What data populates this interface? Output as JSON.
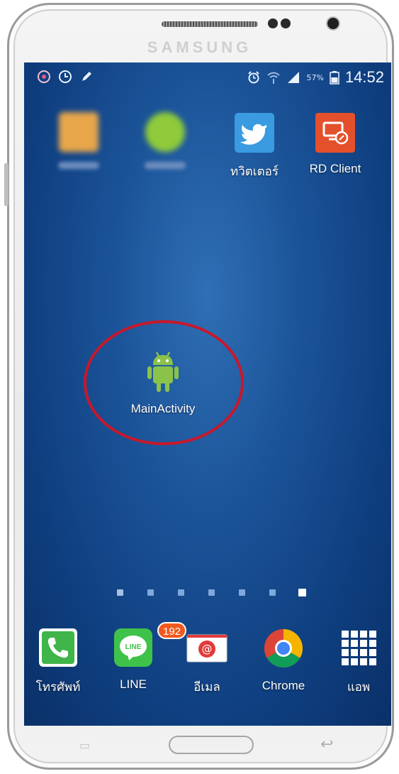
{
  "device": {
    "brand": "SAMSUNG"
  },
  "status_bar": {
    "time": "14:52",
    "battery_percent": "57%",
    "left_icons": [
      "messenger-icon",
      "clock-icon",
      "pencil-icon"
    ],
    "right_icons": [
      "alarm-icon",
      "wifi-icon",
      "signal-icon",
      "battery-icon"
    ]
  },
  "home_screen": {
    "top_row": [
      {
        "label": "",
        "icon": "blurred-orange-app-icon",
        "color": "#e8a64a"
      },
      {
        "label": "",
        "icon": "blurred-green-app-icon",
        "color": "#8fcb3a"
      },
      {
        "label": "ทวิตเตอร์",
        "icon": "twitter-icon",
        "color": "#3a9be0"
      },
      {
        "label": "RD Client",
        "icon": "rd-client-icon",
        "color": "#e4502c"
      }
    ],
    "highlighted_app": {
      "label": "MainActivity",
      "icon": "android-icon",
      "color": "#8bc34a"
    },
    "highlight_color": "#c8182b",
    "page_count": 7,
    "current_page": 7
  },
  "dock": [
    {
      "label": "โทรศัพท์",
      "icon": "phone-icon",
      "color": "#3fb54a"
    },
    {
      "label": "LINE",
      "icon": "line-icon",
      "color": "#3fc24a",
      "badge": "192"
    },
    {
      "label": "อีเมล",
      "icon": "email-icon",
      "color": "#e23a3a"
    },
    {
      "label": "Chrome",
      "icon": "chrome-icon"
    },
    {
      "label": "แอพ",
      "icon": "apps-grid-icon"
    }
  ]
}
